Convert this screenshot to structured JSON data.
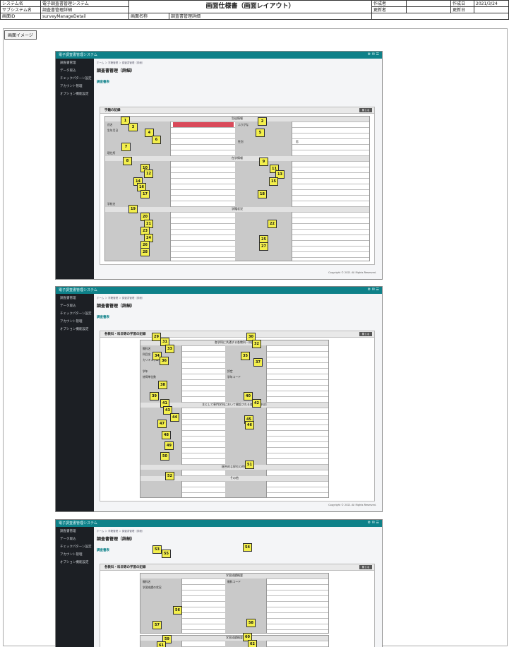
{
  "header": {
    "system_label": "システム名",
    "system_value": "電子調査書管理システム",
    "subsystem_label": "サブシステム名",
    "subsystem_value": "調査書管理詳細",
    "screen_id_label": "画面ID",
    "screen_id_value": "surveyManageDetail",
    "screen_name_label": "画面名称",
    "screen_name_value": "調査書管理詳細",
    "doc_title": "画面仕様書（画面レイアウト）",
    "author_label": "作成者",
    "updater_label": "更新者",
    "created_date_label": "作成日",
    "created_date_value": "2021/3/24",
    "updated_date_label": "更新日"
  },
  "section_tab": "画面イメージ",
  "app": {
    "brand": "電子調査書管理システム",
    "sidebar": [
      "調査書管理",
      "データ取込",
      "チェックパターン設定",
      "アカウント管理",
      "オプション機能設定"
    ],
    "breadcrumb": "ホーム ＞ 学籍管理 ＞ 調査書管理（詳細）",
    "page_title": "調査書管理（詳細）",
    "subheading": "調査書表",
    "copyright": "Copyright © 2021 All Rights Reserved."
  },
  "screens": [
    {
      "card_title": "学籍の記録",
      "button": "閉じる",
      "sections": [
        "生徒情報",
        "在学情報",
        "学籍状況"
      ],
      "cells": [
        "氏名",
        "ふりがな",
        "生年月日",
        "性別",
        "現住所",
        "学校名",
        "男"
      ],
      "markers": [
        "1",
        "2",
        "3",
        "4",
        "5",
        "6",
        "7",
        "8",
        "9",
        "10",
        "11",
        "12",
        "13",
        "14",
        "15",
        "16",
        "17",
        "18",
        "19",
        "20",
        "21",
        "22",
        "23",
        "24",
        "25",
        "26",
        "27",
        "28"
      ]
    },
    {
      "card_title": "各教科・科目等の学習の記録",
      "button": "閉じる",
      "sections": [
        "各学科に共通する各教科・科目",
        "主として専門学科において開設される各教科・科目",
        "総合的な探究の時間",
        "その他"
      ],
      "cells": [
        "教科名",
        "科目名",
        "カリキュラム",
        "学年",
        "修得単位数",
        "評定",
        "学年コード"
      ],
      "markers": [
        "29",
        "30",
        "31",
        "32",
        "33",
        "34",
        "35",
        "36",
        "37",
        "38",
        "39",
        "40",
        "41",
        "42",
        "43",
        "44",
        "45",
        "46",
        "47",
        "48",
        "49",
        "50",
        "51",
        "52"
      ]
    },
    {
      "card_title": "各教科・科目等の学習の記録",
      "button": "閉じる",
      "sections": [
        "学習成績概要",
        "学習成績概要"
      ],
      "cells": [
        "教科名",
        "教科コード",
        "学習成績の状況"
      ],
      "markers": [
        "53",
        "54",
        "55",
        "56",
        "57",
        "58",
        "59",
        "60",
        "61",
        "62",
        "63"
      ]
    }
  ]
}
